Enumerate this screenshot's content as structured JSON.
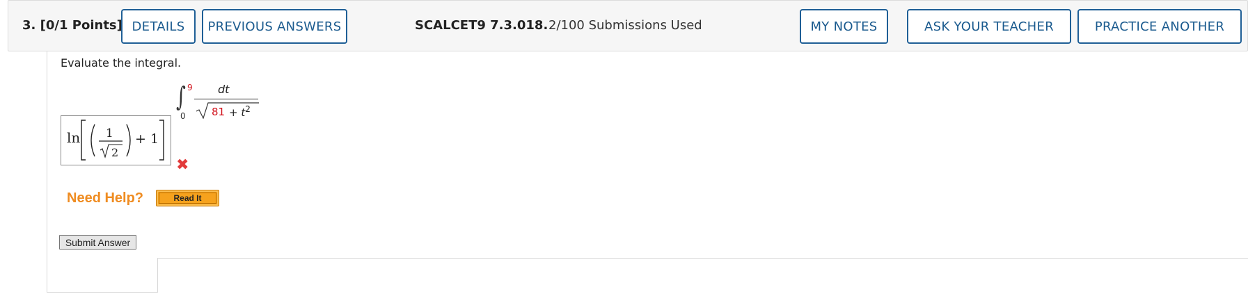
{
  "header": {
    "question_number": "3.",
    "points": "[0/1 Points]",
    "buttons": {
      "details": "DETAILS",
      "previous_answers": "PREVIOUS ANSWERS",
      "my_notes": "MY NOTES",
      "ask_teacher": "ASK YOUR TEACHER",
      "practice_another": "PRACTICE ANOTHER"
    },
    "problem_code": "SCALCET9 7.3.018.",
    "submissions": "2/100 Submissions Used"
  },
  "question": {
    "prompt": "Evaluate the integral.",
    "integral": {
      "lower_limit": "0",
      "upper_limit": "9",
      "numerator": "dt",
      "denominator_constant": "81",
      "denominator_rest": "+ t",
      "exponent": "2"
    }
  },
  "answer": {
    "func": "ln",
    "frac_numerator": "1",
    "frac_denominator": "2",
    "plus": "+ 1",
    "status_icon": "incorrect-x-icon"
  },
  "help": {
    "label": "Need Help?",
    "read_it": "Read It"
  },
  "submit": {
    "label": "Submit Answer"
  },
  "colors": {
    "accent_blue": "#1f5f96",
    "randomized_red": "#d2141e",
    "help_orange": "#ef8c21",
    "error_red": "#e23b3b"
  }
}
